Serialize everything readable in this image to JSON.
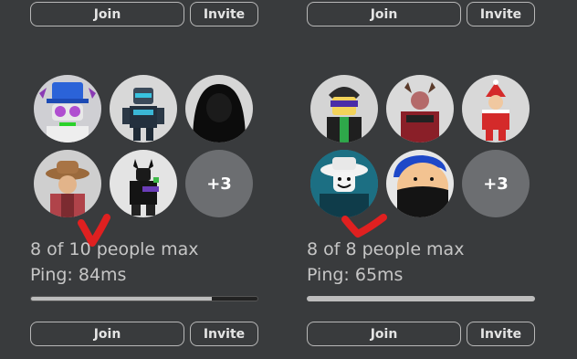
{
  "servers": [
    {
      "join_label": "Join",
      "invite_label": "Invite",
      "capacity_text": "8 of 10 people max",
      "ping_text": "Ping: 84ms",
      "fill_fraction": 0.8,
      "extra_players": "+3"
    },
    {
      "join_label": "Join",
      "invite_label": "Invite",
      "capacity_text": "8 of 8 people max",
      "ping_text": "Ping: 65ms",
      "fill_fraction": 1.0,
      "extra_players": "+3"
    }
  ],
  "colors": {
    "background": "#393b3d",
    "button_border": "#b8b8b8",
    "text": "#c6c6c6",
    "progress_fill": "#bdbdbd",
    "annotation_red": "#e02020"
  }
}
